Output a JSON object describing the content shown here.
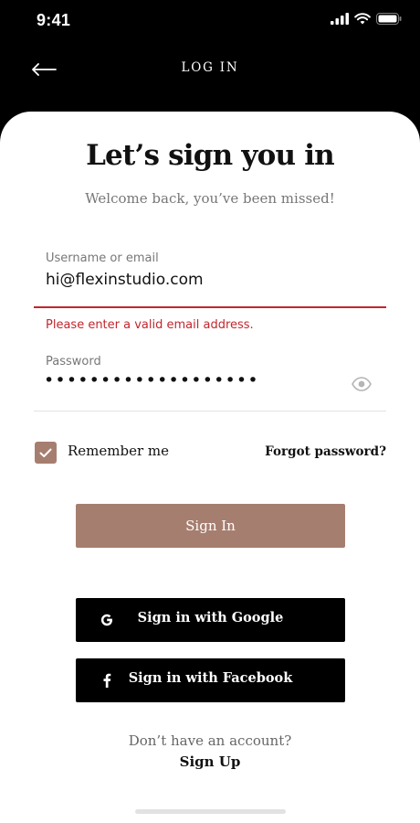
{
  "status_bar": {
    "time": "9:41",
    "icons": [
      "signal-icon",
      "wifi-icon",
      "battery-icon"
    ]
  },
  "nav": {
    "title": "LOG IN",
    "back_icon": "arrow-left-icon"
  },
  "header": {
    "title": "Let’s sign you in",
    "subtitle": "Welcome back, you’ve been missed!"
  },
  "form": {
    "email": {
      "label": "Username or email",
      "value": "hi@flexinstudio.com",
      "error": "Please enter a valid email address."
    },
    "password": {
      "label": "Password",
      "value": "•••••••••••••••••••",
      "toggle_icon": "eye-icon"
    },
    "remember": {
      "label": "Remember me",
      "checked": true
    },
    "forgot_label": "Forgot password?",
    "submit_label": "Sign In"
  },
  "social": {
    "google_label": "Sign in with Google",
    "facebook_label": "Sign in with Facebook"
  },
  "footer": {
    "prompt": "Don’t have an account?",
    "signup_label": "Sign Up"
  },
  "colors": {
    "accent": "#a67e6f",
    "error": "#c0272d",
    "background": "#000000",
    "card": "#ffffff"
  }
}
